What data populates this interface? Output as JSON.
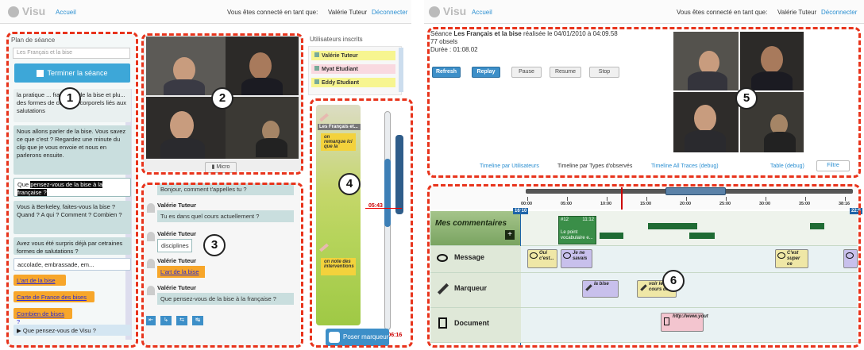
{
  "left_app": {
    "logo": "Visu",
    "accueil": "Accueil",
    "connected_label": "Vous êtes connecté en tant que:",
    "user": "Valérie Tuteur",
    "logout": "Déconnecter",
    "plan_title": "Plan de séance",
    "session_select": "Les Français et la bise",
    "end_button": "Terminer la séance",
    "plan_items": [
      "la pratique ... française de la bise et plu... des formes de contacts corporels liés aux salutations",
      "Nous allons parler de la bise. Vous savez ce que c'est ? Regardez une minute du clip que je vous envoie et nous en parlerons ensuite.",
      "Que pensez-vous de la bise à la française ?",
      "Vous à Berkeley, faites-vous la bise ? Quand ? A qui ? Comment ? Combien ?",
      "Avez vous été surpris déjà par cetraines formes de salutations ?",
      "accolade, embrassade, em...",
      "L'art de la bise",
      "Carte de France des bises",
      "Combien de bises ?",
      "Que pensez-vous de Visu ?"
    ],
    "micro": "Micro",
    "users_title": "Utilisateurs inscrits",
    "users": [
      "Valérie Tuteur",
      "Myat Etudiant",
      "Eddy Etudiant"
    ],
    "chat": [
      {
        "name": "Valérie Tuteur",
        "text": "Bonjour, comment t'appelles tu ?"
      },
      {
        "name": "Valérie Tuteur",
        "text": "Tu es dans quel cours actuellement ?"
      },
      {
        "name": "Valérie Tuteur",
        "text": "disciplines"
      },
      {
        "name": "Valérie Tuteur",
        "text": "L'art de la bise"
      },
      {
        "name": "Valérie Tuteur",
        "text": "Que pensez-vous de la bise à la française ?"
      }
    ],
    "timeline_title": "Les Français et...",
    "marker1": "on remarque ici que la",
    "marker2": "on note des interventions",
    "time_now": "05:43",
    "time_end": "-06:16",
    "poser_marqueur": "Poser marqueur"
  },
  "right_app": {
    "logo": "Visu",
    "accueil": "Accueil",
    "connected_label": "Vous êtes connecté en tant que:",
    "user": "Valérie Tuteur",
    "logout": "Déconnecter",
    "seance_prefix": "Séance",
    "seance_name": "Les Français et la bise",
    "seance_suffix": "réalisée le 04/01/2010 à 04:09.58",
    "obsels": "77 obsels",
    "duree": "Durée : 01:08.02",
    "buttons": [
      "Refresh",
      "Replay",
      "Pause",
      "Resume",
      "Stop"
    ],
    "links": [
      "Timeline par Utilisateurs",
      "Timeline par Types d'observés",
      "Timeline All Traces (debug)",
      "Table (debug)"
    ],
    "filtre": "Filtre",
    "ruler_ticks": [
      "00:00",
      "05:00",
      "10:00",
      "15:00",
      "20:00",
      "25:00",
      "30:00",
      "35:00",
      "38:16"
    ],
    "start_time": "16:10",
    "end_time": "22:5",
    "rows": [
      "Mes commentaires",
      "Message",
      "Marqueur",
      "Document"
    ],
    "comment_tag": "#12",
    "comment_time": "11:12",
    "comment_text": "Le point vocabulaire e...",
    "messages": [
      "Oui c'est...",
      "Je ne savais",
      "C'est super ce"
    ],
    "marqueurs": [
      "la bise",
      "voir le cours de"
    ],
    "document": "http://www.yout"
  },
  "callouts": [
    "1",
    "2",
    "3",
    "4",
    "5",
    "6"
  ]
}
